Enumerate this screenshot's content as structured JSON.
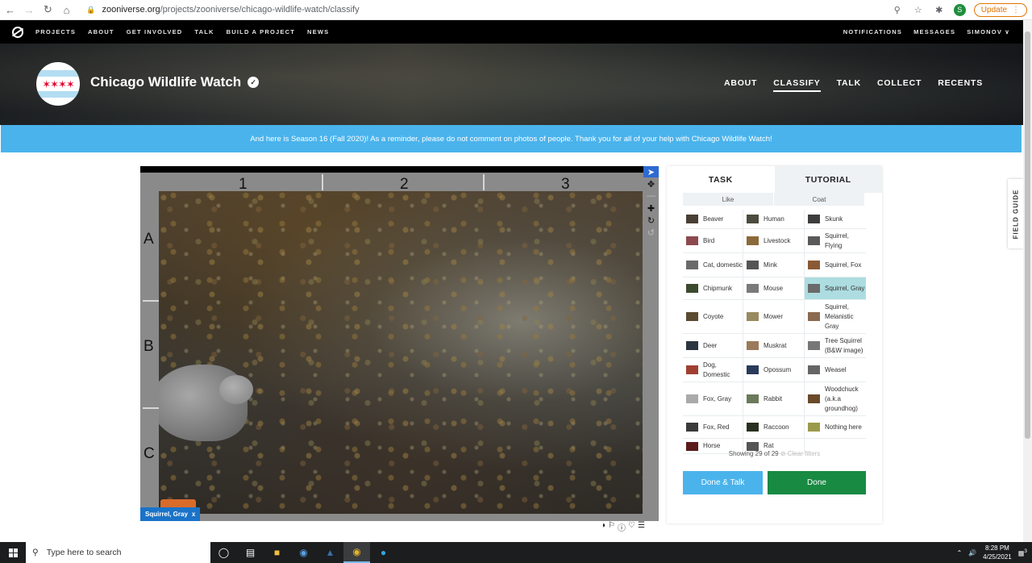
{
  "browser": {
    "url_host": "zooniverse.org",
    "url_path": "/projects/zooniverse/chicago-wildlife-watch/classify",
    "profile_initial": "S",
    "update_label": "Update"
  },
  "topbar": {
    "nav": [
      "PROJECTS",
      "ABOUT",
      "GET INVOLVED",
      "TALK",
      "BUILD A PROJECT",
      "NEWS"
    ],
    "right": [
      "NOTIFICATIONS",
      "MESSAGES",
      "SIMONOV ∨"
    ]
  },
  "project": {
    "title": "Chicago Wildlife Watch",
    "nav": [
      "ABOUT",
      "CLASSIFY",
      "TALK",
      "COLLECT",
      "RECENTS"
    ],
    "active_nav": "CLASSIFY"
  },
  "announcement": "And here is Season 16 (Fall 2020)! As a reminder, please do not comment on photos of people. Thank you for all of your help with Chicago Wildlife Watch!",
  "viewer": {
    "columns": [
      "1",
      "2",
      "3"
    ],
    "rows": [
      "A",
      "B",
      "C"
    ],
    "tag_label": "Squirrel, Gray",
    "tag_close": "x"
  },
  "task_panel": {
    "tabs": [
      "TASK",
      "TUTORIAL"
    ],
    "filters": [
      "Like",
      "Coat"
    ],
    "species": [
      {
        "label": "Beaver",
        "color": "#4a3f35"
      },
      {
        "label": "Human",
        "color": "#4c4c3e"
      },
      {
        "label": "Skunk",
        "color": "#3d3d3d"
      },
      {
        "label": "Bird",
        "color": "#8c4a4f"
      },
      {
        "label": "Livestock",
        "color": "#8a6a3a"
      },
      {
        "label": "Squirrel, Flying",
        "color": "#5a5a5a"
      },
      {
        "label": "Cat, domestic",
        "color": "#6a6a6a"
      },
      {
        "label": "Mink",
        "color": "#555"
      },
      {
        "label": "Squirrel, Fox",
        "color": "#8a5a35"
      },
      {
        "label": "Chipmunk",
        "color": "#3c4a2e"
      },
      {
        "label": "Mouse",
        "color": "#7a7a7a"
      },
      {
        "label": "Squirrel, Gray",
        "color": "#6a6a6a",
        "selected": true
      },
      {
        "label": "Coyote",
        "color": "#5a4a30"
      },
      {
        "label": "Mower",
        "color": "#9a8a60"
      },
      {
        "label": "Squirrel, Melanistic Gray",
        "color": "#8a6a50"
      },
      {
        "label": "Deer",
        "color": "#2a3540"
      },
      {
        "label": "Muskrat",
        "color": "#9a7a5a"
      },
      {
        "label": "Tree Squirrel (B&W image)",
        "color": "#777"
      },
      {
        "label": "Dog, Domestic",
        "color": "#a04030"
      },
      {
        "label": "Opossum",
        "color": "#2a3a5a"
      },
      {
        "label": "Weasel",
        "color": "#666"
      },
      {
        "label": "Fox, Gray",
        "color": "#aaa"
      },
      {
        "label": "Rabbit",
        "color": "#6a7a5a"
      },
      {
        "label": "Woodchuck (a.k.a groundhog)",
        "color": "#6a4a2a"
      },
      {
        "label": "Fox, Red",
        "color": "#3a3a3a"
      },
      {
        "label": "Raccoon",
        "color": "#2a3020"
      },
      {
        "label": "Nothing here",
        "color": "#9a9a4a"
      },
      {
        "label": "Horse",
        "color": "#5a1a1a"
      },
      {
        "label": "Rat",
        "color": "#555"
      }
    ],
    "showing": "Showing 29 of 29",
    "clear_filters": "⊘ Clear filters",
    "done_talk_label": "Done & Talk",
    "done_label": "Done"
  },
  "field_guide_label": "FIELD GUIDE",
  "taskbar": {
    "search_placeholder": "Type here to search",
    "time": "8:28 PM",
    "date": "4/25/2021",
    "notification_count": "3"
  }
}
